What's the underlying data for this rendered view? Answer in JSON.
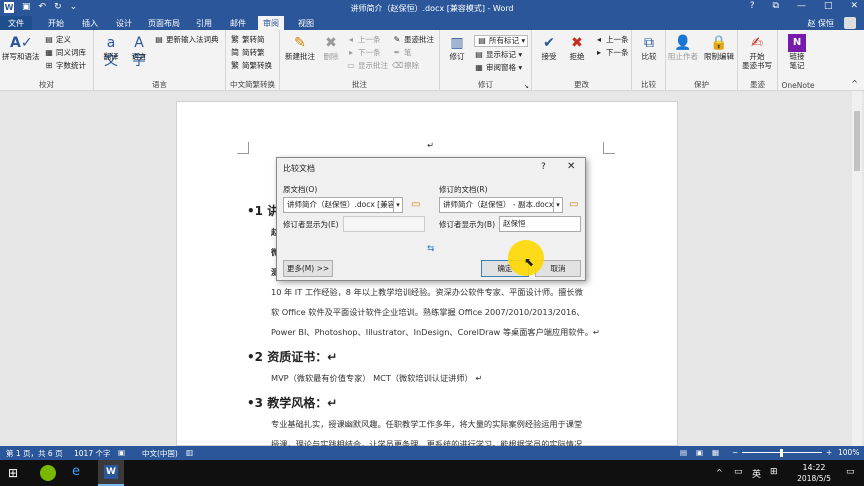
{
  "window": {
    "title": "讲师简介（赵保恒）.docx [兼容模式] - Word"
  },
  "qat": {
    "save_icon": "save-icon",
    "undo": "↶",
    "redo": "↻",
    "custom": "⌄"
  },
  "window_controls": {
    "help": "?",
    "restore": "⧉",
    "minimize": "—",
    "maximize": "□",
    "close": "✕"
  },
  "tabs": [
    "文件",
    "开始",
    "插入",
    "设计",
    "页面布局",
    "引用",
    "邮件",
    "审阅",
    "视图"
  ],
  "user": {
    "name": "赵 保恒"
  },
  "ribbon": {
    "proofing": {
      "label": "校对",
      "spell": "拼写和语法",
      "define": "定义",
      "thesaurus": "同义词库",
      "wordcount": "字数统计"
    },
    "language": {
      "label": "语言",
      "translate": "翻译",
      "language": "语言",
      "update_ime": "更新输入法词典"
    },
    "chinese": {
      "label": "中文简繁转换",
      "to_trad": "繁转简",
      "to_simp": "简转繁",
      "convert": "简繁转换"
    },
    "comments": {
      "label": "批注",
      "new": "新建批注",
      "delete": "删除",
      "prev": "上一条",
      "next": "下一条",
      "show": "显示批注",
      "ink": "墨迹批注",
      "pen": "笔",
      "erase": "擦除"
    },
    "tracking": {
      "label": "修订",
      "track": "修订",
      "markup": "所有标记",
      "show_markup": "显示标记",
      "pane": "审阅窗格"
    },
    "changes": {
      "label": "更改",
      "accept": "接受",
      "reject": "拒绝",
      "prev": "上一条",
      "next": "下一条"
    },
    "compare": {
      "label": "比较",
      "compare": "比较"
    },
    "protect": {
      "label": "保护",
      "block": "阻止作者",
      "restrict": "限制编辑"
    },
    "ink": {
      "label": "墨迹",
      "start": "开始",
      "start2": "墨迹书写"
    },
    "onenote": {
      "label": "OneNote",
      "link": "链接",
      "link2": "笔记"
    }
  },
  "document": {
    "lines": [
      {
        "num": "1",
        "text": "讲"
      },
      {
        "text": "赵"
      },
      {
        "text": "微"
      },
      {
        "text": "测"
      },
      {
        "text": "10 年 IT 工作经验，8 年以上教学培训经验。资深办公软件专家、平面设计师。擅长微"
      },
      {
        "text": "软 Office 软件及平面设计软件企业培训。熟练掌握 Office 2007/2010/2013/2016、"
      },
      {
        "text": "Power BI、Photoshop、Illustrator、InDesign、CorelDraw 等桌面客户端应用软件。↵"
      }
    ],
    "sec2": {
      "num": "2",
      "title": "资质证书：↵",
      "body": "MVP（微软最有价值专家）  MCT（微软培训认证讲师）  ↵"
    },
    "sec3": {
      "num": "3",
      "title": "教学风格：↵",
      "body1": "专业基础扎实，授课幽默风趣。任职教学工作多年，将大量的实际案例经验运用于课堂",
      "body2": "授课，理论与实践相结合，让学员更条理、更系统的进行学习。能根据学员的实际情况"
    },
    "top_mark": "↵"
  },
  "dialog": {
    "title": "比较文档",
    "help": "?",
    "close": "✕",
    "orig_label": "原文档(O)",
    "orig_value": "讲师简介（赵保恒）.docx [兼容",
    "orig_author_label": "修订者显示为(E)",
    "orig_author_value": "",
    "rev_label": "修订的文档(R)",
    "rev_value": "讲师简介（赵保恒） - 副本.docx",
    "rev_author_label": "修订者显示为(B)",
    "rev_author_value": "赵保恒",
    "swap": "⇆",
    "more": "更多(M) >>",
    "ok": "确定",
    "cancel": "取消"
  },
  "status": {
    "page": "第 1 页，共 6 页",
    "words": "1017 个字",
    "lang": "中文(中国)",
    "zoom": "100%"
  },
  "taskbar": {
    "ime": "英",
    "time": "14:22",
    "date": "2018/5/5"
  }
}
